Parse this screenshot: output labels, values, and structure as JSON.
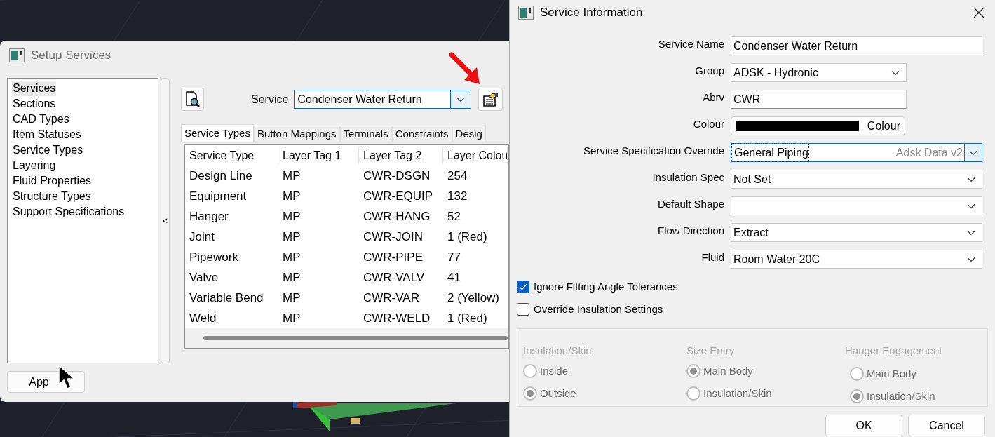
{
  "setup_window": {
    "title": "Setup Services",
    "sidebar": {
      "items": [
        {
          "label": "Services",
          "selected": true
        },
        {
          "label": "Sections",
          "selected": false
        },
        {
          "label": "CAD Types",
          "selected": false
        },
        {
          "label": "Item Statuses",
          "selected": false
        },
        {
          "label": "Service Types",
          "selected": false
        },
        {
          "label": "Layering",
          "selected": false
        },
        {
          "label": "Fluid Properties",
          "selected": false
        },
        {
          "label": "Structure Types",
          "selected": false
        },
        {
          "label": "Support Specifications",
          "selected": false
        }
      ]
    },
    "splitter_label": "<",
    "service_label": "Service",
    "service_value": "Condenser Water Return",
    "tabs": [
      {
        "label": "Service Types",
        "selected": true
      },
      {
        "label": "Button Mappings",
        "selected": false
      },
      {
        "label": "Terminals",
        "selected": false
      },
      {
        "label": "Constraints",
        "selected": false
      },
      {
        "label": "Desig",
        "selected": false
      }
    ],
    "table": {
      "columns": [
        "Service Type",
        "Layer Tag 1",
        "Layer Tag 2",
        "Layer Colou"
      ],
      "rows": [
        [
          "Design Line",
          "MP",
          "CWR-DSGN",
          "254"
        ],
        [
          "Equipment",
          "MP",
          "CWR-EQUIP",
          "132"
        ],
        [
          "Hanger",
          "MP",
          "CWR-HANG",
          "52"
        ],
        [
          "Joint",
          "MP",
          "CWR-JOIN",
          "1 (Red)"
        ],
        [
          "Pipework",
          "MP",
          "CWR-PIPE",
          "77"
        ],
        [
          "Valve",
          "MP",
          "CWR-VALV",
          "41"
        ],
        [
          "Variable Bend",
          "MP",
          "CWR-VAR",
          "2 (Yellow)"
        ],
        [
          "Weld",
          "MP",
          "CWR-WELD",
          "1 (Red)"
        ]
      ]
    },
    "apply_button": "App"
  },
  "dialog": {
    "title": "Service Information",
    "fields": [
      {
        "kind": "text",
        "label": "Service Name",
        "value": "Condenser Water Return"
      },
      {
        "kind": "short_combo",
        "label": "Group",
        "value": "ADSK - Hydronic"
      },
      {
        "kind": "short_text",
        "label": "Abrv",
        "value": "CWR"
      },
      {
        "kind": "colour",
        "label": "Colour",
        "button_label": "Colour"
      },
      {
        "kind": "spec",
        "label": "Service Specification Override",
        "value": "General Piping",
        "source": "Adsk Data v2"
      },
      {
        "kind": "combo",
        "label": "Insulation Spec",
        "value": "Not Set"
      },
      {
        "kind": "combo",
        "label": "Default Shape"
      },
      {
        "kind": "combo",
        "label": "Flow Direction",
        "value": "Extract"
      },
      {
        "kind": "combo",
        "label": "Fluid",
        "value": "Room Water 20C"
      }
    ],
    "checkboxes": [
      {
        "label": "Ignore Fitting Angle Tolerances",
        "checked": true
      },
      {
        "label": "Override Insulation Settings",
        "checked": false
      }
    ],
    "options_disabled": true,
    "option_groups": [
      {
        "title": "Insulation/Skin",
        "options": [
          {
            "label": "Inside",
            "selected": false
          },
          {
            "label": "Outside",
            "selected": true
          }
        ]
      },
      {
        "title": "Size Entry",
        "options": [
          {
            "label": "Main Body",
            "selected": true
          },
          {
            "label": "Insulation/Skin",
            "selected": false
          }
        ]
      },
      {
        "title": "Hanger Engagement",
        "options": [
          {
            "label": "Main Body",
            "selected": false
          },
          {
            "label": "Insulation/Skin",
            "selected": true
          }
        ]
      }
    ],
    "buttons": [
      "OK",
      "Cancel"
    ]
  }
}
